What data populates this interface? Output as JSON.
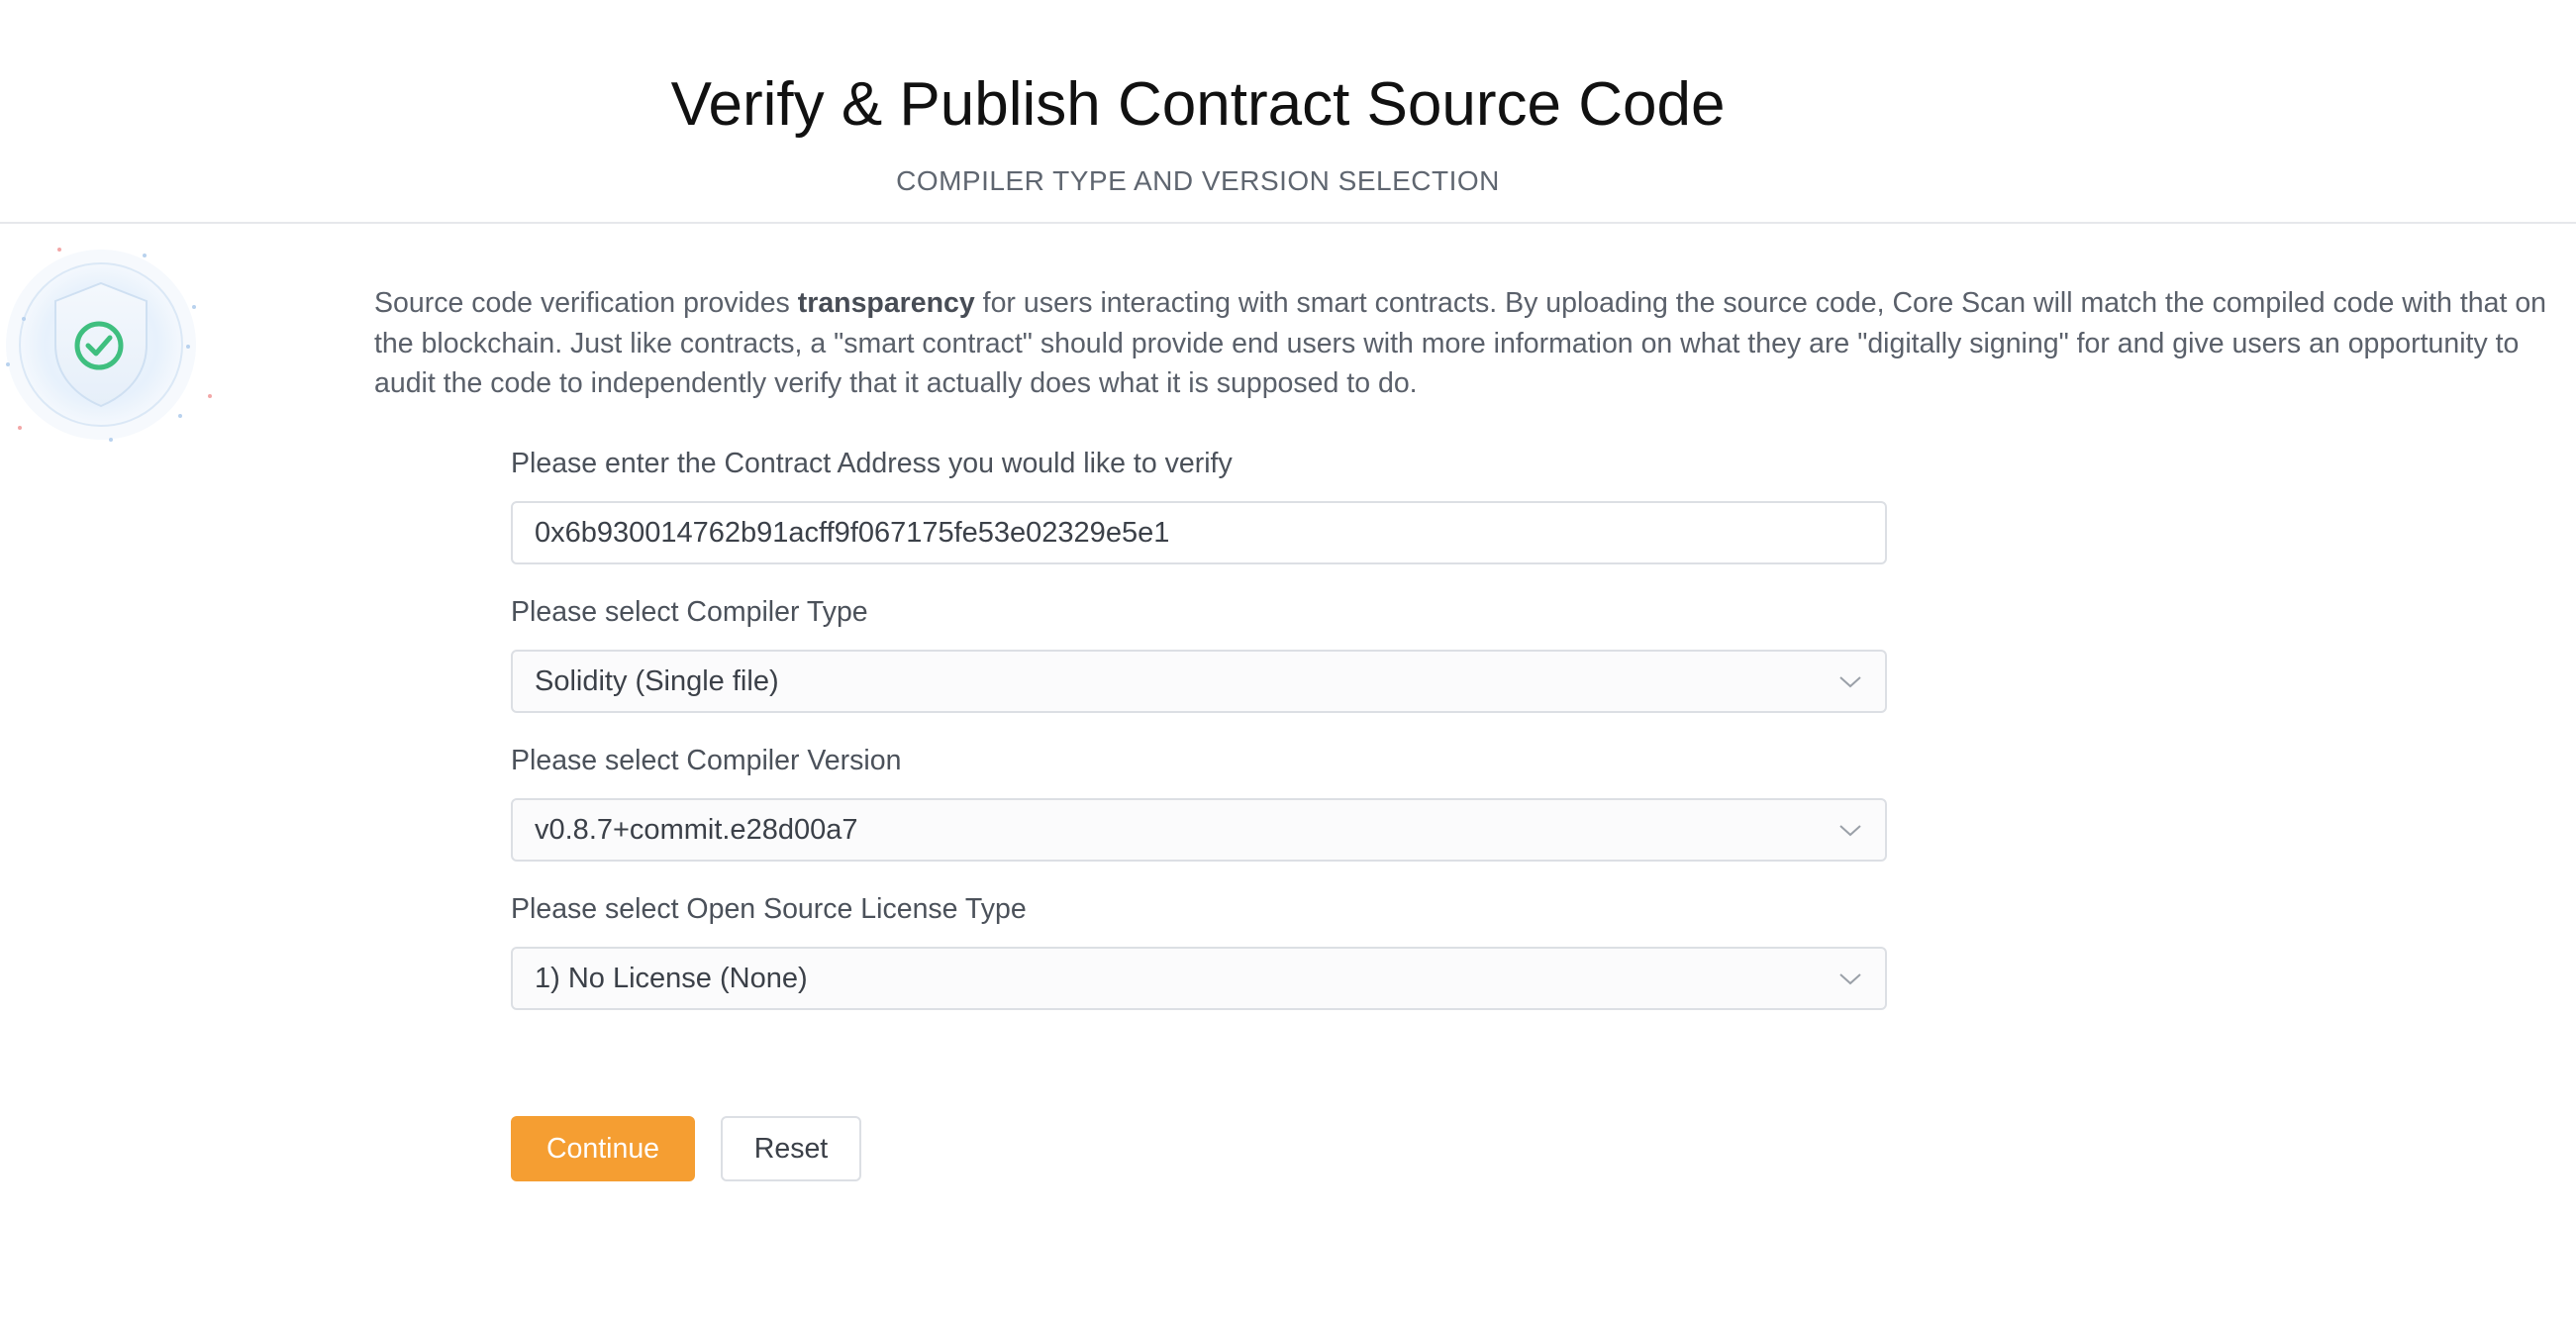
{
  "header": {
    "title": "Verify & Publish Contract Source Code",
    "subtitle": "COMPILER TYPE AND VERSION SELECTION"
  },
  "intro": {
    "text_before": "Source code verification provides ",
    "bold": "transparency",
    "text_after": " for users interacting with smart contracts. By uploading the source code, Core Scan will match the compiled code with that on the blockchain. Just like contracts, a \"smart contract\" should provide end users with more information on what they are \"digitally signing\" for and give users an opportunity to audit the code to independently verify that it actually does what it is supposed to do."
  },
  "form": {
    "address": {
      "label": "Please enter the Contract Address you would like to verify",
      "value": "0x6b930014762b91acff9f067175fe53e02329e5e1"
    },
    "compiler_type": {
      "label": "Please select Compiler Type",
      "value": "Solidity (Single file)"
    },
    "compiler_version": {
      "label": "Please select Compiler Version",
      "value": "v0.8.7+commit.e28d00a7"
    },
    "license": {
      "label": "Please select Open Source License Type",
      "value": "1) No License (None)"
    }
  },
  "buttons": {
    "continue": "Continue",
    "reset": "Reset"
  },
  "colors": {
    "accent": "#f59e32",
    "badge_check": "#3fbf7f"
  },
  "icons": {
    "badge": "shield-check-icon",
    "dropdown": "chevron-down-icon"
  }
}
